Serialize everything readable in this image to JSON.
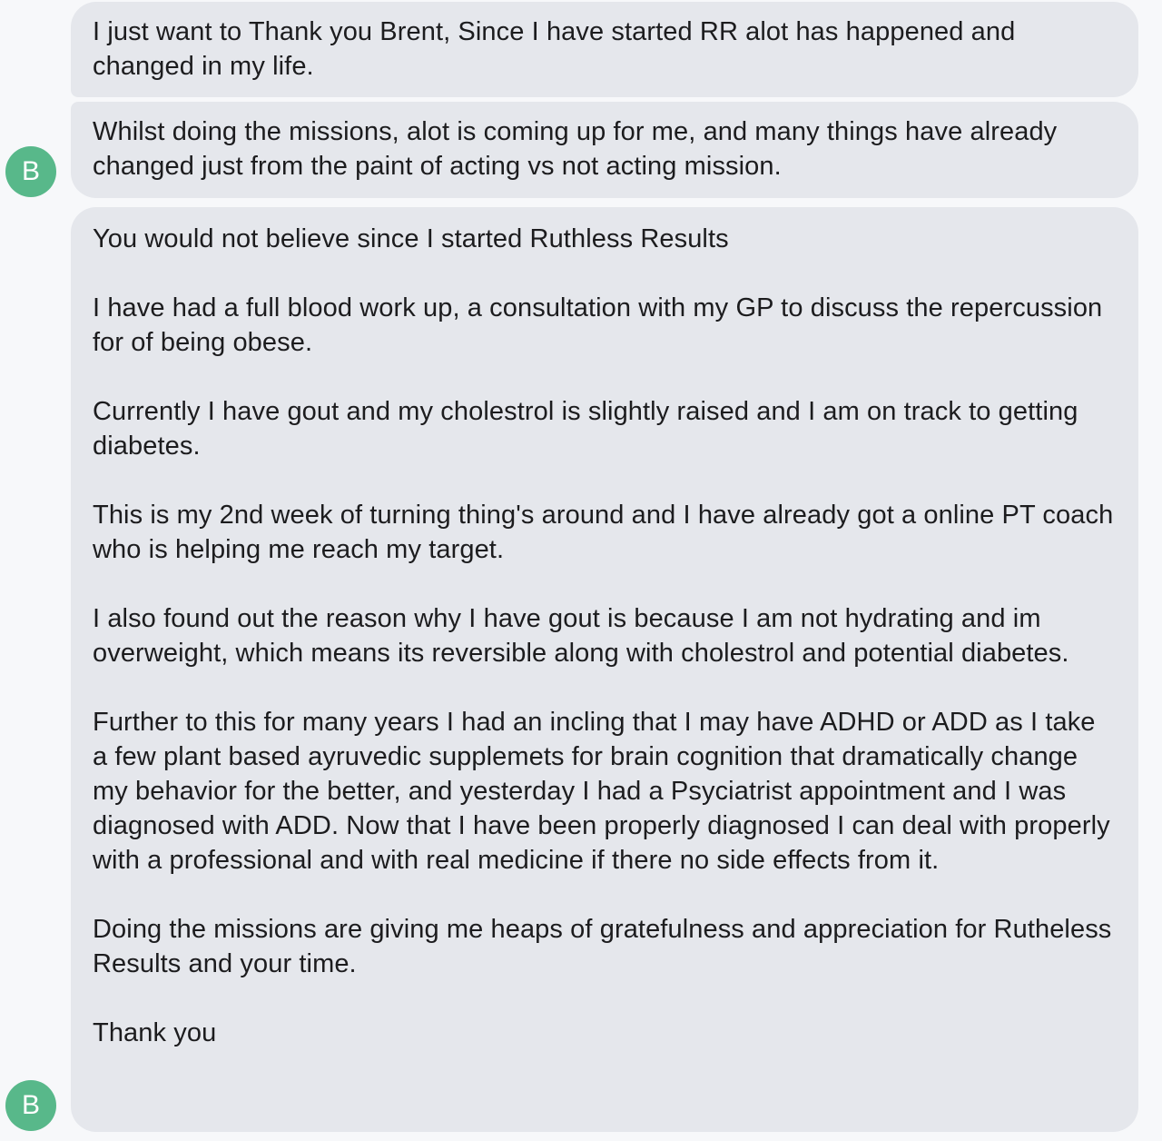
{
  "avatar": {
    "initial": "B",
    "color": "#58b88a"
  },
  "bubble_color": "#e5e7ec",
  "messages": [
    {
      "paragraphs": [
        "I just want to Thank you Brent, Since I have started RR alot has happened and changed in my life."
      ]
    },
    {
      "paragraphs": [
        "Whilst doing the missions, alot is coming up for me, and many things have already changed just from the paint of acting vs not acting mission."
      ]
    },
    {
      "paragraphs": [
        "You would not believe since I started Ruthless Results",
        "I have had a full blood work up, a consultation with my GP to discuss the repercussion for of being obese.",
        "Currently I have gout and my cholestrol is slightly raised and I am on track to getting diabetes.",
        "This is my 2nd week of turning thing's around and I have already got a online PT coach who is helping me reach my target.",
        "I also found out the reason why I have gout is because I am not hydrating and im overweight, which means its reversible along with cholestrol and potential diabetes.",
        "Further to this for many years I had an incling that I may have ADHD or ADD as I take a few plant based ayruvedic supplemets for brain cognition that dramatically change my behavior for the better, and yesterday I had a Psyciatrist appointment and I was diagnosed with ADD. Now that I have been properly diagnosed I can deal with properly with a professional and with real medicine if there no side effects from it.",
        "Doing the missions are giving me heaps of gratefulness and appreciation for Rutheless Results and your time.",
        "Thank you"
      ]
    }
  ]
}
